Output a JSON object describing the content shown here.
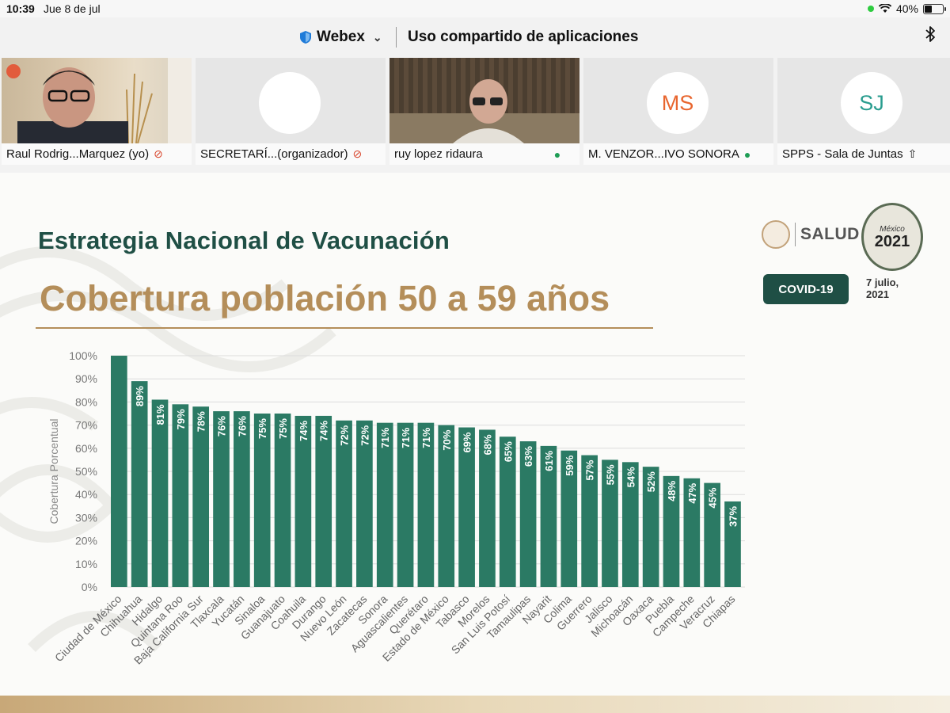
{
  "status_bar": {
    "time": "10:39",
    "date": "Jue 8 de jul",
    "battery": "40%"
  },
  "header": {
    "app_name": "Webex",
    "share_title": "Uso compartido de aplicaciones"
  },
  "participants": [
    {
      "name": "Raul Rodrig...Marquez (yo)",
      "mic": "muted"
    },
    {
      "name": "SECRETARÍ...(organizador)",
      "mic": "muted"
    },
    {
      "name": "ruy lopez ridaura",
      "mic": "active"
    },
    {
      "name": "M. VENZOR...IVO SONORA",
      "mic": "active",
      "initials": "MS"
    },
    {
      "name": "SPPS - Sala de Juntas",
      "initials": "SJ"
    }
  ],
  "colors": {
    "accent_green": "#1f4f45",
    "gold": "#b48e5a",
    "bar": "#2b7a64",
    "ms_orange": "#e8662f",
    "sj_teal": "#2a9d8f"
  },
  "slide": {
    "heading": "Estrategia Nacional de Vacunación",
    "subheading": "Cobertura población 50 a 59 años",
    "logo_text": "SALUD",
    "logo_2021_top": "México",
    "logo_2021_year": "2021",
    "badge": "COVID-19",
    "date_line1": "7 julio,",
    "date_line2": "2021"
  },
  "chart_data": {
    "type": "bar",
    "ylabel": "Cobertura Porcentual",
    "ylim": [
      0,
      100
    ],
    "yticks": [
      "0%",
      "10%",
      "20%",
      "30%",
      "40%",
      "50%",
      "60%",
      "70%",
      "80%",
      "90%",
      "100%"
    ],
    "grid": true,
    "categories": [
      "Ciudad de México",
      "Chihuahua",
      "Hidalgo",
      "Quintana Roo",
      "Baja California Sur",
      "Tlaxcala",
      "Yucatán",
      "Sinaloa",
      "Guanajuato",
      "Coahuila",
      "Durango",
      "Nuevo León",
      "Zacatecas",
      "Sonora",
      "Aguascalientes",
      "Querétaro",
      "Estado de México",
      "Tabasco",
      "Morelos",
      "San Luis Potosí",
      "Tamaulipas",
      "Nayarit",
      "Colima",
      "Guerrero",
      "Jalisco",
      "Michoacán",
      "Oaxaca",
      "Puebla",
      "Campeche",
      "Veracruz",
      "Chiapas"
    ],
    "values": [
      100,
      89,
      81,
      79,
      78,
      76,
      76,
      75,
      75,
      74,
      74,
      72,
      72,
      71,
      71,
      71,
      70,
      69,
      68,
      65,
      63,
      61,
      59,
      57,
      55,
      54,
      52,
      48,
      47,
      45,
      37
    ],
    "labels": [
      "",
      "89%",
      "81%",
      "79%",
      "78%",
      "76%",
      "76%",
      "75%",
      "75%",
      "74%",
      "74%",
      "72%",
      "72%",
      "71%",
      "71%",
      "71%",
      "70%",
      "69%",
      "68%",
      "65%",
      "63%",
      "61%",
      "59%",
      "57%",
      "55%",
      "54%",
      "52%",
      "48%",
      "47%",
      "45%",
      "37%"
    ]
  }
}
